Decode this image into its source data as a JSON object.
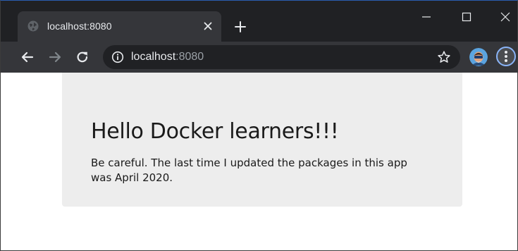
{
  "browser": {
    "tab": {
      "title": "localhost:8080",
      "favicon_icon": "globe-icon",
      "close_icon": "close-icon"
    },
    "new_tab_icon": "plus-icon",
    "window_controls": {
      "minimize_icon": "minimize-icon",
      "maximize_icon": "maximize-icon",
      "close_icon": "window-close-icon"
    },
    "toolbar": {
      "back_icon": "arrow-left-icon",
      "forward_icon": "arrow-right-icon",
      "reload_icon": "reload-icon",
      "site_info_icon": "info-icon",
      "url_host": "localhost",
      "url_port": ":8080",
      "bookmark_icon": "star-icon",
      "profile_icon": "avatar",
      "menu_icon": "kebab-menu-icon"
    },
    "colors": {
      "tabstrip": "#202124",
      "toolbar": "#35363a",
      "omnibox": "#202124",
      "accent": "#8ab4f8"
    }
  },
  "page": {
    "heading": "Hello Docker learners!!!",
    "message": "Be careful. The last time I updated the packages in this app was April 2020.",
    "colors": {
      "card_background": "#ededed",
      "text": "#1a1a1a"
    }
  }
}
